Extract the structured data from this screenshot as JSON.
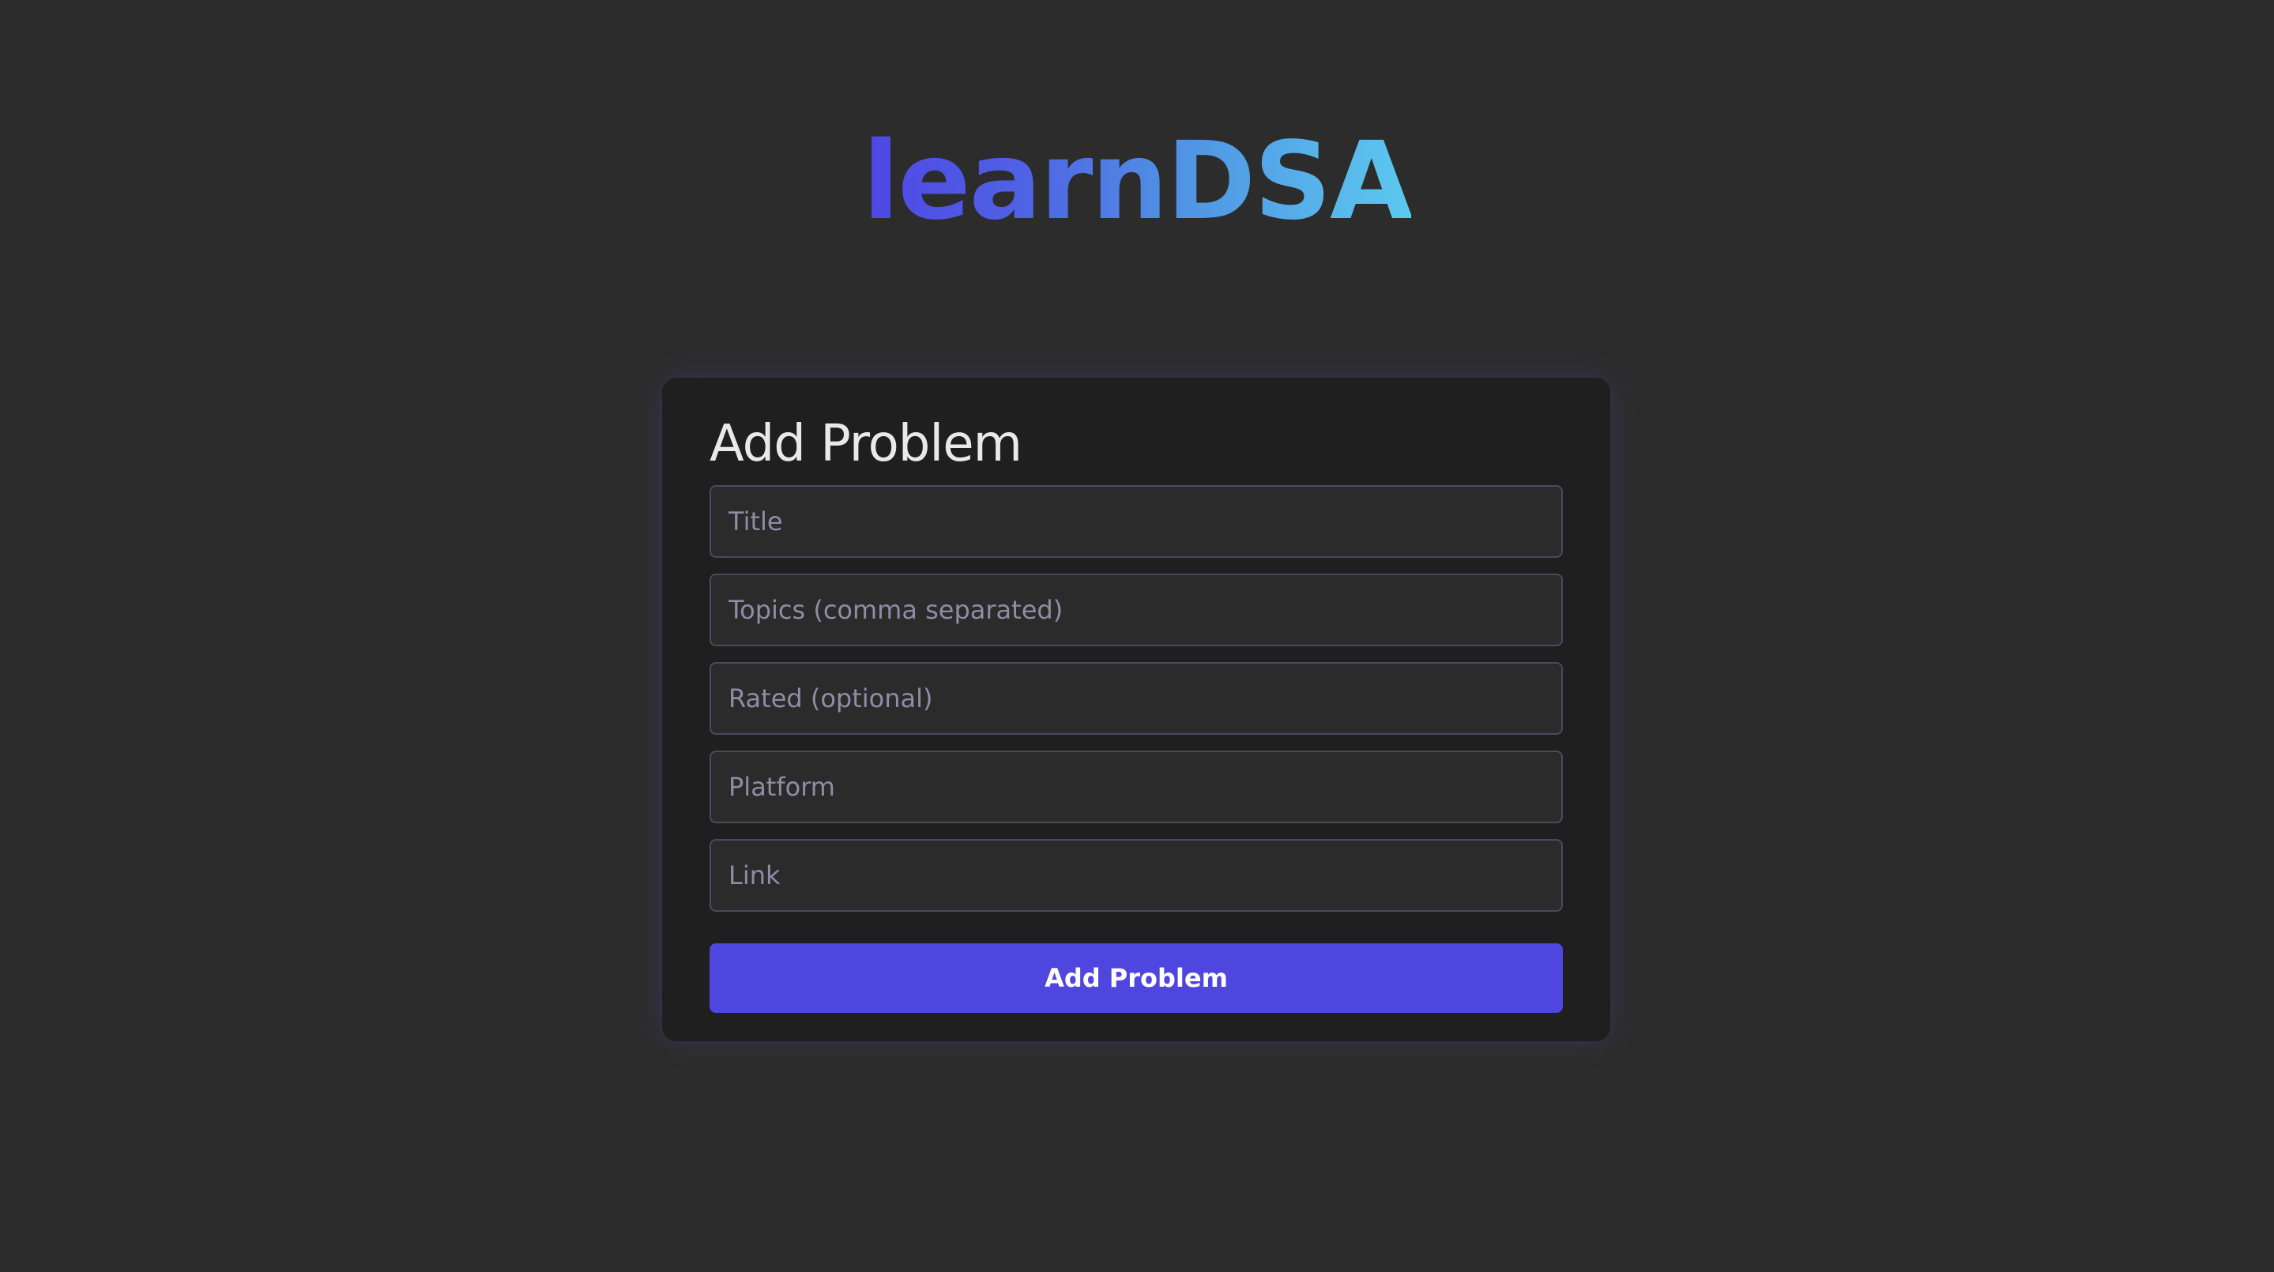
{
  "app": {
    "title": "learnDSA",
    "gradient_colors": [
      "#4f46e5",
      "#5cc9ef"
    ]
  },
  "form": {
    "heading": "Add Problem",
    "fields": [
      {
        "name": "title",
        "placeholder": "Title",
        "value": ""
      },
      {
        "name": "topics",
        "placeholder": "Topics (comma separated)",
        "value": ""
      },
      {
        "name": "rated",
        "placeholder": "Rated (optional)",
        "value": ""
      },
      {
        "name": "platform",
        "placeholder": "Platform",
        "value": ""
      },
      {
        "name": "link",
        "placeholder": "Link",
        "value": ""
      }
    ],
    "submit_label": "Add Problem",
    "accent_color": "#4f46e0"
  }
}
